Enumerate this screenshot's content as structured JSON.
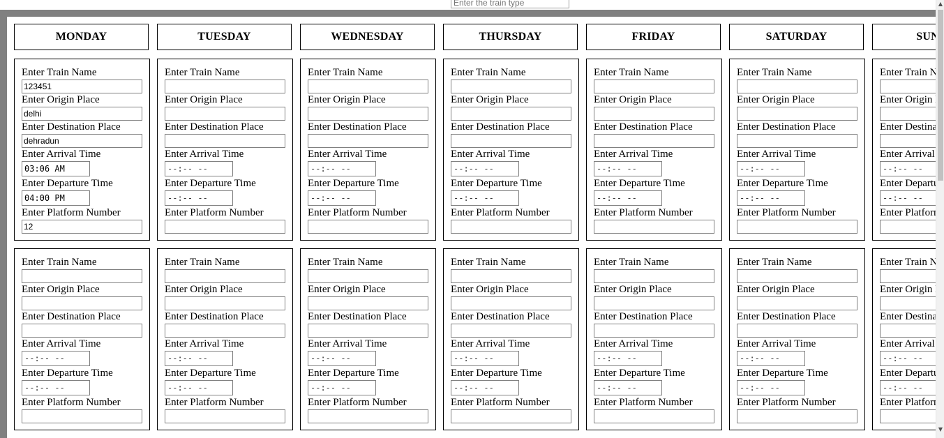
{
  "train_type": {
    "placeholder": "Enter the train type"
  },
  "labels": {
    "train_name": "Enter Train Name",
    "origin": "Enter Origin Place",
    "destination": "Enter Destination Place",
    "arrival": "Enter Arrival Time",
    "departure": "Enter Departure Time",
    "platform": "Enter Platform Number"
  },
  "time_placeholder": "--:-- --",
  "days": [
    {
      "name": "MONDAY",
      "entries": [
        {
          "train_name": "123451",
          "origin": "delhi",
          "destination": "dehradun",
          "arrival": "03:06 AM",
          "departure": "04:00 PM",
          "platform": "12"
        },
        {
          "train_name": "",
          "origin": "",
          "destination": "",
          "arrival": "",
          "departure": "",
          "platform": ""
        }
      ]
    },
    {
      "name": "TUESDAY",
      "entries": [
        {
          "train_name": "",
          "origin": "",
          "destination": "",
          "arrival": "",
          "departure": "",
          "platform": ""
        },
        {
          "train_name": "",
          "origin": "",
          "destination": "",
          "arrival": "",
          "departure": "",
          "platform": ""
        }
      ]
    },
    {
      "name": "WEDNESDAY",
      "entries": [
        {
          "train_name": "",
          "origin": "",
          "destination": "",
          "arrival": "",
          "departure": "",
          "platform": ""
        },
        {
          "train_name": "",
          "origin": "",
          "destination": "",
          "arrival": "",
          "departure": "",
          "platform": ""
        }
      ]
    },
    {
      "name": "THURSDAY",
      "entries": [
        {
          "train_name": "",
          "origin": "",
          "destination": "",
          "arrival": "",
          "departure": "",
          "platform": ""
        },
        {
          "train_name": "",
          "origin": "",
          "destination": "",
          "arrival": "",
          "departure": "",
          "platform": ""
        }
      ]
    },
    {
      "name": "FRIDAY",
      "entries": [
        {
          "train_name": "",
          "origin": "",
          "destination": "",
          "arrival": "",
          "departure": "",
          "platform": ""
        },
        {
          "train_name": "",
          "origin": "",
          "destination": "",
          "arrival": "",
          "departure": "",
          "platform": ""
        }
      ]
    },
    {
      "name": "SATURDAY",
      "entries": [
        {
          "train_name": "",
          "origin": "",
          "destination": "",
          "arrival": "",
          "departure": "",
          "platform": ""
        },
        {
          "train_name": "",
          "origin": "",
          "destination": "",
          "arrival": "",
          "departure": "",
          "platform": ""
        }
      ]
    },
    {
      "name": "SUNDAY",
      "entries": [
        {
          "train_name": "",
          "origin": "",
          "destination": "",
          "arrival": "",
          "departure": "",
          "platform": ""
        },
        {
          "train_name": "",
          "origin": "",
          "destination": "",
          "arrival": "",
          "departure": "",
          "platform": ""
        }
      ]
    }
  ],
  "scrollbar": {
    "up_icon": "scroll-up-arrow-icon",
    "down_icon": "scroll-down-arrow-icon"
  }
}
